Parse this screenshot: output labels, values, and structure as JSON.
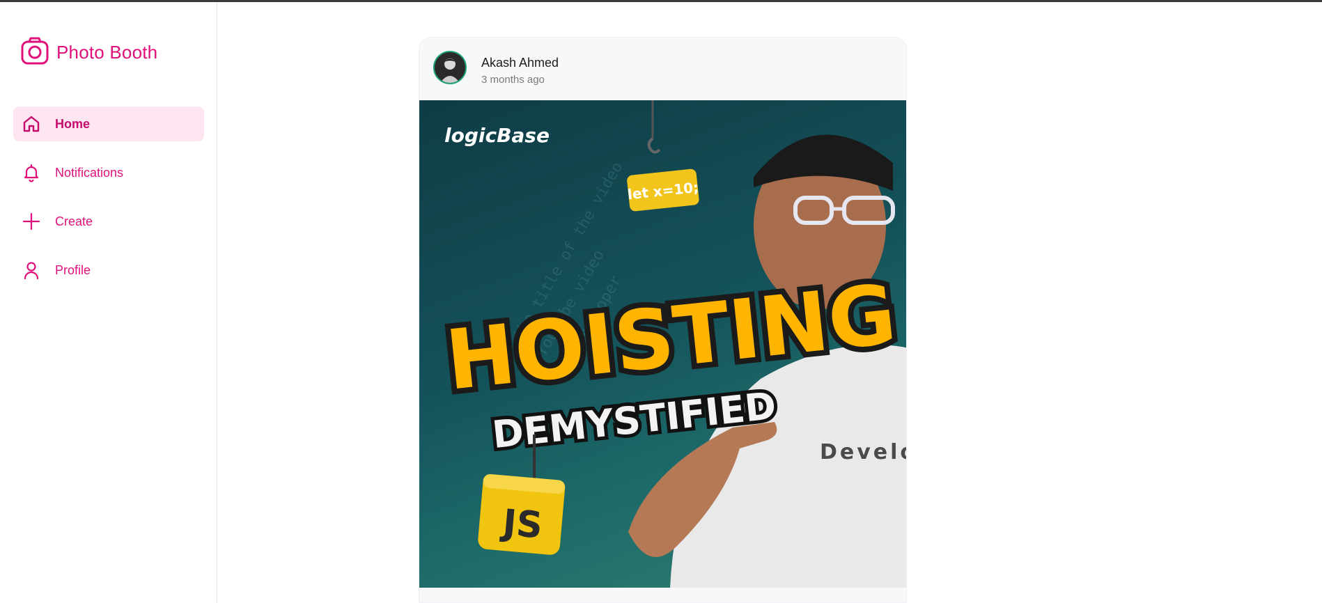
{
  "app": {
    "name": "Photo Booth"
  },
  "nav": {
    "items": [
      {
        "label": "Home",
        "icon": "home-icon",
        "active": true
      },
      {
        "label": "Notifications",
        "icon": "bell-icon",
        "active": false
      },
      {
        "label": "Create",
        "icon": "plus-icon",
        "active": false
      },
      {
        "label": "Profile",
        "icon": "user-icon",
        "active": false
      }
    ]
  },
  "post": {
    "author": "Akash Ahmed",
    "time": "3 months ago",
    "image": {
      "brand": "logicBase",
      "hook_tag": "let x=10;",
      "headline": "HOISTING",
      "subheadline": "DEMYSTIFIED",
      "badge": "JS",
      "shirt_text": "Develop"
    }
  },
  "colors": {
    "accent": "#e0107a",
    "active_bg": "#fde6f1",
    "avatar_ring": "#1ea47b",
    "post_bg": "#f7f8fa"
  }
}
